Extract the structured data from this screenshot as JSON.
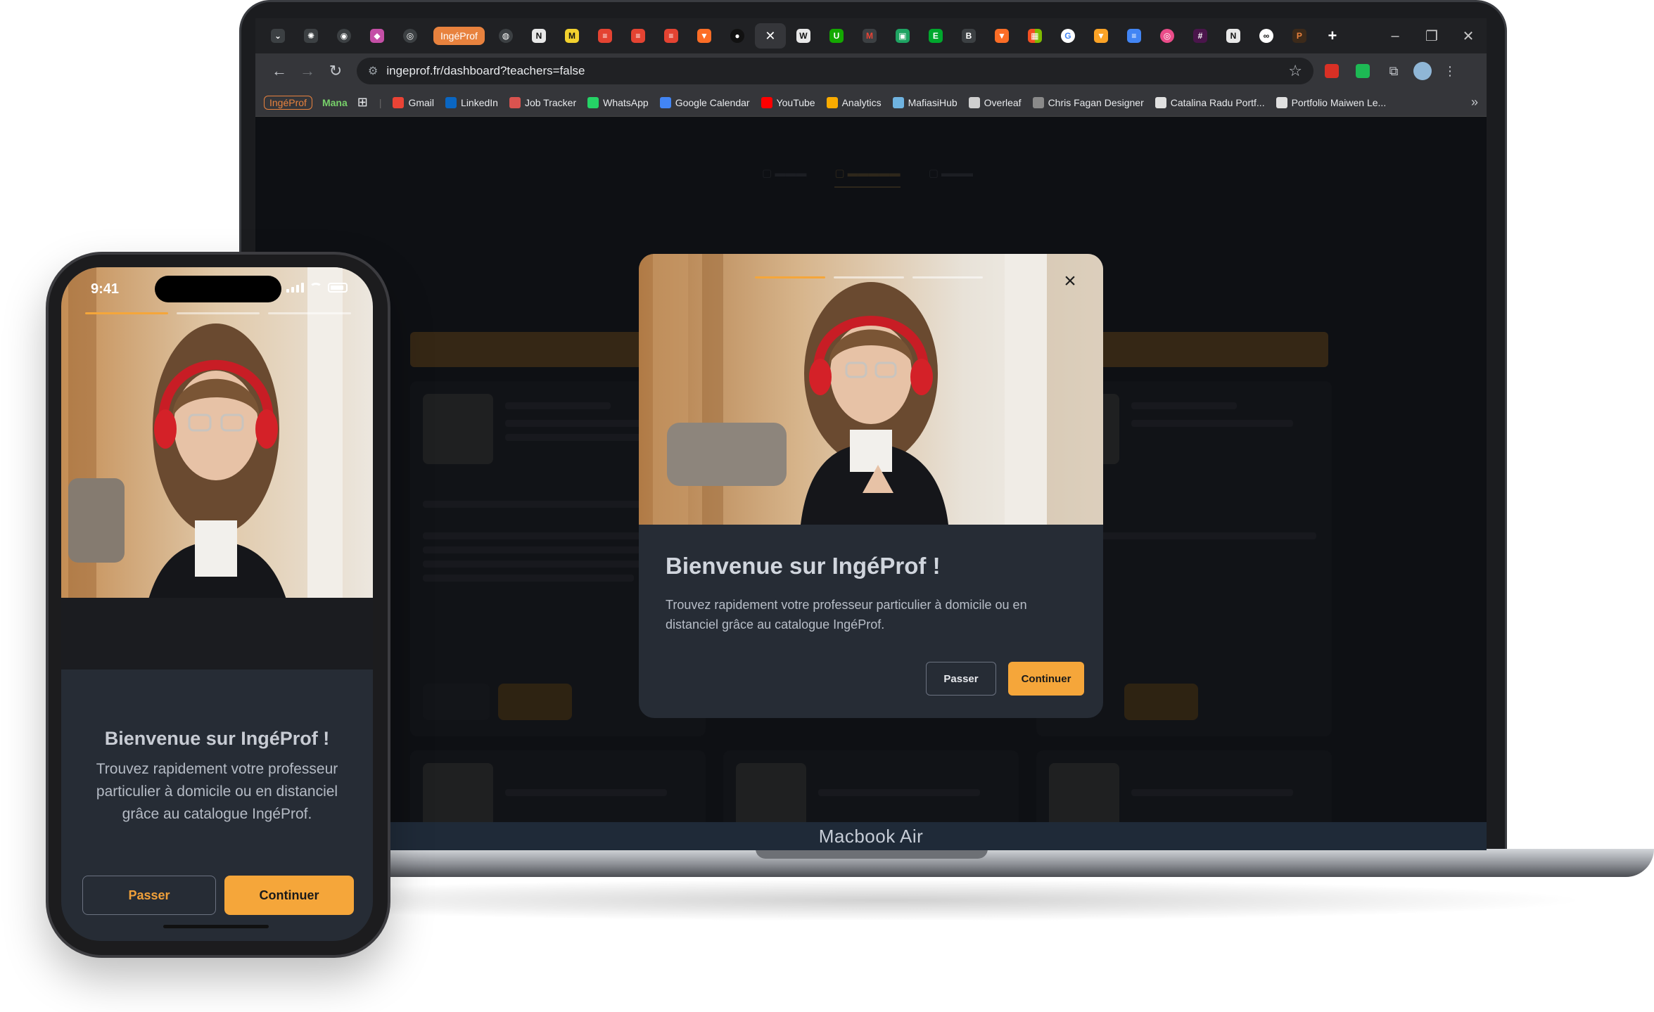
{
  "laptop": {
    "device_label": "Macbook Air",
    "browser": {
      "active_tab_label": "IngéProf",
      "url": "ingeprof.fr/dashboard?teachers=false",
      "bookmarks": [
        {
          "label": "Gmail",
          "color": "#ea4335"
        },
        {
          "label": "LinkedIn",
          "color": "#0a66c2"
        },
        {
          "label": "Job Tracker",
          "color": "#d9534f"
        },
        {
          "label": "WhatsApp",
          "color": "#25d366"
        },
        {
          "label": "Google Calendar",
          "color": "#4285f4"
        },
        {
          "label": "YouTube",
          "color": "#ff0000"
        },
        {
          "label": "Analytics",
          "color": "#f9ab00"
        },
        {
          "label": "MafiasiHub",
          "color": "#6fb3e0"
        },
        {
          "label": "Overleaf",
          "color": "#cfcfcf"
        },
        {
          "label": "Chris Fagan Designer",
          "color": "#8a8a8a"
        },
        {
          "label": "Catalina Radu Portf...",
          "color": "#e0e0e0"
        },
        {
          "label": "Portfolio Maiwen Le...",
          "color": "#e0e0e0"
        }
      ],
      "bookmark_brand": "IngéProf",
      "bookmark_mana": "Mana"
    },
    "modal": {
      "title": "Bienvenue sur IngéProf !",
      "text": "Trouvez rapidement votre professeur particulier à domicile ou en distanciel grâce au catalogue IngéProf.",
      "skip_label": "Passer",
      "continue_label": "Continuer",
      "close_icon": "close-icon",
      "progress": {
        "steps": 3,
        "current": 1
      }
    }
  },
  "phone": {
    "status_time": "9:41",
    "title": "Bienvenue sur IngéProf !",
    "text": "Trouvez rapidement votre professeur particulier à domicile ou en distanciel grâce au catalogue IngéProf.",
    "skip_label": "Passer",
    "continue_label": "Continuer",
    "progress": {
      "steps": 3,
      "current": 1
    }
  },
  "colors": {
    "accent": "#f5a63a",
    "modal_bg": "#262c35",
    "page_bg": "#16181c"
  }
}
